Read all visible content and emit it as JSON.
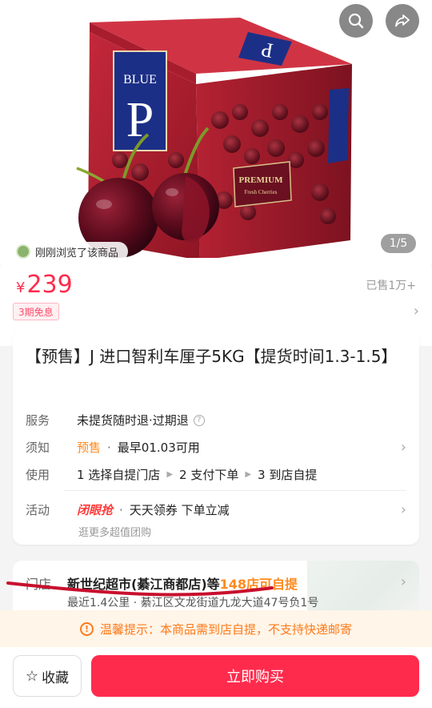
{
  "hero": {
    "page_indicator": "1/5",
    "viewed_text": "刚刚浏览了该商品",
    "box_brand_letter": "P",
    "box_brand_word": "BLUE",
    "box_premium": "PREMIUM",
    "box_sub": "Fresh Cherries",
    "icons": {
      "search": "search-icon",
      "share": "share-icon"
    }
  },
  "price": {
    "symbol": "¥",
    "value": "239",
    "sold": "已售1万+",
    "installment": "3期免息"
  },
  "product": {
    "title": "【预售】J 进口智利车厘子5KG【提货时间1.3-1.5】"
  },
  "details": {
    "service_label": "服务",
    "service_value": "未提货随时退·过期退",
    "notice_label": "须知",
    "notice_presale": "预售",
    "notice_value": "最早01.03可用",
    "usage_label": "使用",
    "steps": [
      "1 选择自提门店",
      "2 支付下单",
      "3 到店自提"
    ],
    "activity_label": "活动",
    "activity_hot": "闭眼抢",
    "activity_value": "天天领券 下单立减",
    "activity_sub": "逛更多超值团购"
  },
  "store": {
    "label": "门店",
    "name": "新世纪超市(綦江商都店)等",
    "count": "148店可自提",
    "address": "最近1.4公里 · 綦江区文龙街道九龙大道47号负1号"
  },
  "tip": {
    "text": "温馨提示：本商品需到店自提，不支持快递邮寄"
  },
  "bottom": {
    "favorite": "收藏",
    "buy": "立即购买"
  },
  "colors": {
    "accent": "#ff2b4d",
    "orange": "#ff8a1e",
    "tip_bg": "#fff5e8"
  }
}
